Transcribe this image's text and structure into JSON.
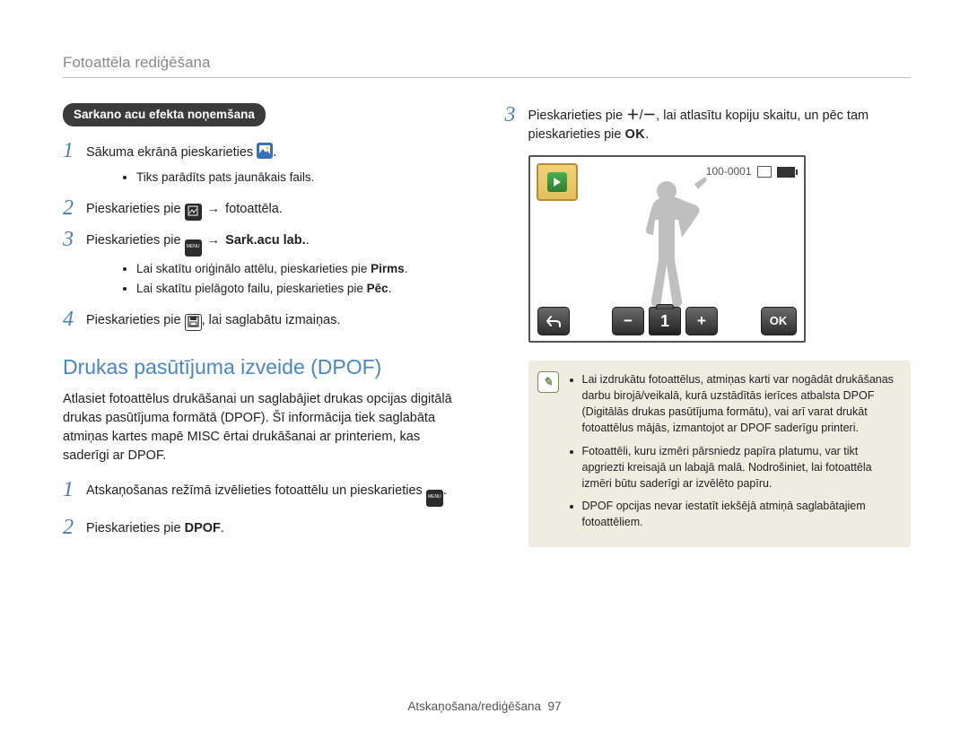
{
  "header": {
    "title": "Fotoattēla rediģēšana"
  },
  "left": {
    "badge": "Sarkano acu efekta noņemšana",
    "step1": {
      "num": "1",
      "text_a": "Sākuma ekrānā pieskarieties ",
      "text_b": ".",
      "sub1": "Tiks parādīts pats jaunākais fails."
    },
    "step2": {
      "num": "2",
      "text_a": "Pieskarieties pie ",
      "arrow": "→",
      "text_b": " fotoattēla."
    },
    "step3": {
      "num": "3",
      "text_a": "Pieskarieties pie ",
      "arrow": "→ ",
      "bold": "Sark.acu lab.",
      "tail": ".",
      "sub1_a": "Lai skatītu oriģinālo attēlu, pieskarieties pie ",
      "sub1_b": "Pirms",
      "sub1_c": ".",
      "sub2_a": "Lai skatītu pielāgoto failu, pieskarieties pie ",
      "sub2_b": "Pēc",
      "sub2_c": "."
    },
    "step4": {
      "num": "4",
      "text_a": "Pieskarieties pie ",
      "text_b": ", lai saglabātu izmaiņas."
    },
    "section_title": "Drukas pasūtījuma izveide (DPOF)",
    "section_para": "Atlasiet fotoattēlus drukāšanai un saglabājiet drukas opcijas digitālā drukas pasūtījuma formātā (DPOF). Šī informācija tiek saglabāta atmiņas kartes mapē MISC ērtai drukāšanai ar printeriem, kas saderīgi ar DPOF.",
    "d_step1": {
      "num": "1",
      "text_a": "Atskaņošanas režīmā izvēlieties fotoattēlu un pieskarieties ",
      "text_b": "."
    },
    "d_step2": {
      "num": "2",
      "text_a": "Pieskarieties pie ",
      "bold": "DPOF",
      "tail": "."
    }
  },
  "right": {
    "step3": {
      "num": "3",
      "text_a": "Pieskarieties pie ",
      "plusminus": "+/−",
      "text_b": ", lai atlasītu kopiju skaitu, un pēc tam pieskarieties pie ",
      "ok": "OK",
      "tail": "."
    },
    "screen": {
      "counter_top": "100-0001",
      "back": "↶",
      "minus": "−",
      "count": "1",
      "plus": "+",
      "ok": "OK"
    },
    "note": {
      "b1": "Lai izdrukātu fotoattēlus, atmiņas karti var nogādāt drukāšanas darbu birojā/veikalā, kurā uzstādītās ierīces atbalsta DPOF (Digitālās drukas pasūtījuma formātu), vai arī varat drukāt fotoattēlus mājās, izmantojot ar DPOF saderīgu printeri.",
      "b2": "Fotoattēli, kuru izmēri pārsniedz papīra platumu, var tikt apgriezti kreisajā un labajā malā. Nodrošiniet, lai fotoattēla izmēri būtu saderīgi ar izvēlēto papīru.",
      "b3": "DPOF opcijas nevar iestatīt iekšējā atmiņā saglabātajiem fotoattēliem."
    }
  },
  "footer": {
    "text": "Atskaņošana/rediģēšana",
    "page": "97"
  }
}
